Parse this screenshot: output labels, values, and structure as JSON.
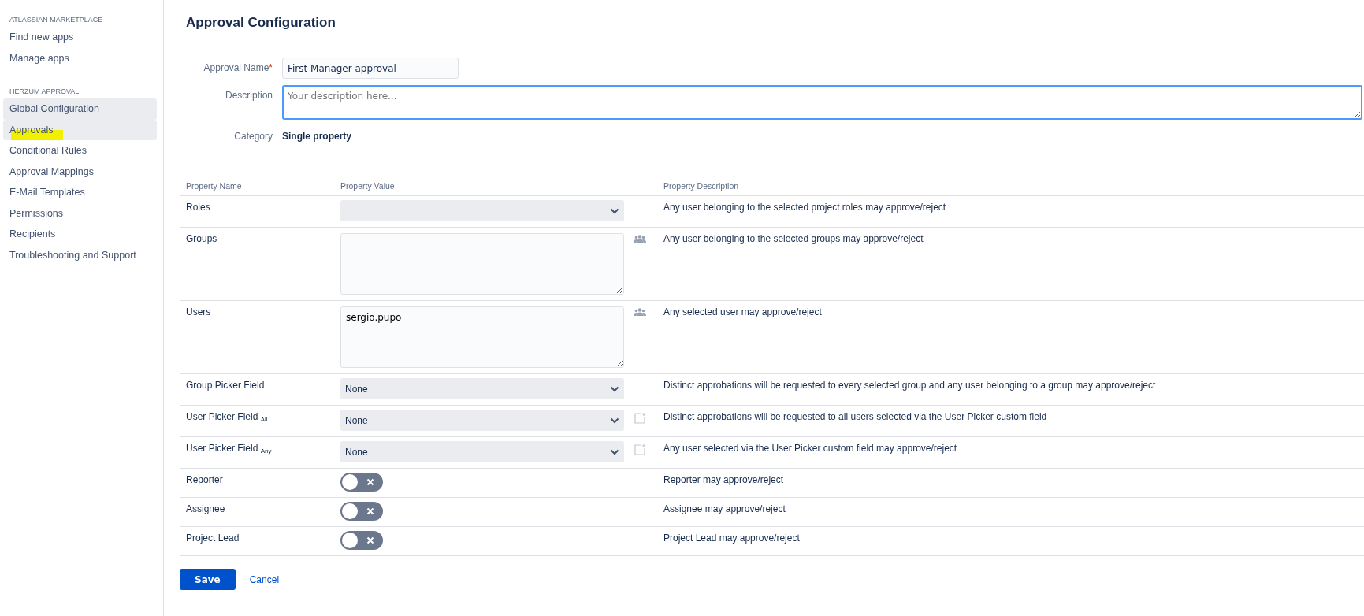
{
  "sidebar": {
    "sections": [
      {
        "heading": "ATLASSIAN MARKETPLACE",
        "items": [
          {
            "label": "Find new apps",
            "selected": false,
            "highlighted": false
          },
          {
            "label": "Manage apps",
            "selected": false,
            "highlighted": false
          }
        ]
      },
      {
        "heading": "HERZUM APPROVAL",
        "items": [
          {
            "label": "Global Configuration",
            "selected": true,
            "highlighted": false
          },
          {
            "label": "Approvals",
            "selected": true,
            "highlighted": true
          },
          {
            "label": "Conditional Rules",
            "selected": false,
            "highlighted": false
          },
          {
            "label": "Approval Mappings",
            "selected": false,
            "highlighted": false
          },
          {
            "label": "E-Mail Templates",
            "selected": false,
            "highlighted": false
          },
          {
            "label": "Permissions",
            "selected": false,
            "highlighted": false
          },
          {
            "label": "Recipients",
            "selected": false,
            "highlighted": false
          },
          {
            "label": "Troubleshooting and Support",
            "selected": false,
            "highlighted": false
          }
        ]
      }
    ]
  },
  "page_title": "Approval Configuration",
  "form": {
    "name": {
      "label": "Approval Name",
      "required_mark": "*",
      "value": "First Manager approval"
    },
    "description": {
      "label": "Description",
      "placeholder": "Your description here...",
      "focused": true
    },
    "category": {
      "label": "Category",
      "value": "Single property"
    }
  },
  "table": {
    "columns": [
      "Property Name",
      "Property Value",
      "Property Description"
    ],
    "rows": [
      {
        "name": "Roles",
        "kind": "select",
        "value": "",
        "description": "Any user belonging to the selected project roles may approve/reject"
      },
      {
        "name": "Groups",
        "kind": "textarea",
        "value": "",
        "description": "Any user belonging to the selected groups may approve/reject"
      },
      {
        "name": "Users",
        "kind": "textarea",
        "value": "sergio.pupo",
        "description": "Any selected user may approve/reject"
      },
      {
        "name": "Group Picker Field",
        "kind": "select",
        "value": "None",
        "description": "Distinct approbations will be requested to every selected group and any user belonging to a group may approve/reject"
      },
      {
        "name": "User Picker Field $_{All}$",
        "kind": "select",
        "value": "None",
        "description": "Distinct approbations will be requested to all users selected via the User Picker custom field"
      },
      {
        "name": "User Picker Field $_{Any}$",
        "kind": "select",
        "value": "None",
        "description": "Any user selected via the User Picker custom field may approve/reject"
      },
      {
        "name": "Reporter",
        "kind": "toggle",
        "on": false,
        "description": "Reporter may approve/reject"
      },
      {
        "name": "Assignee",
        "kind": "toggle",
        "on": false,
        "description": "Assignee may approve/reject"
      },
      {
        "name": "Project Lead",
        "kind": "toggle",
        "on": false,
        "description": "Project Lead may approve/reject"
      }
    ]
  },
  "buttons": {
    "save": "Save",
    "cancel": "Cancel"
  }
}
